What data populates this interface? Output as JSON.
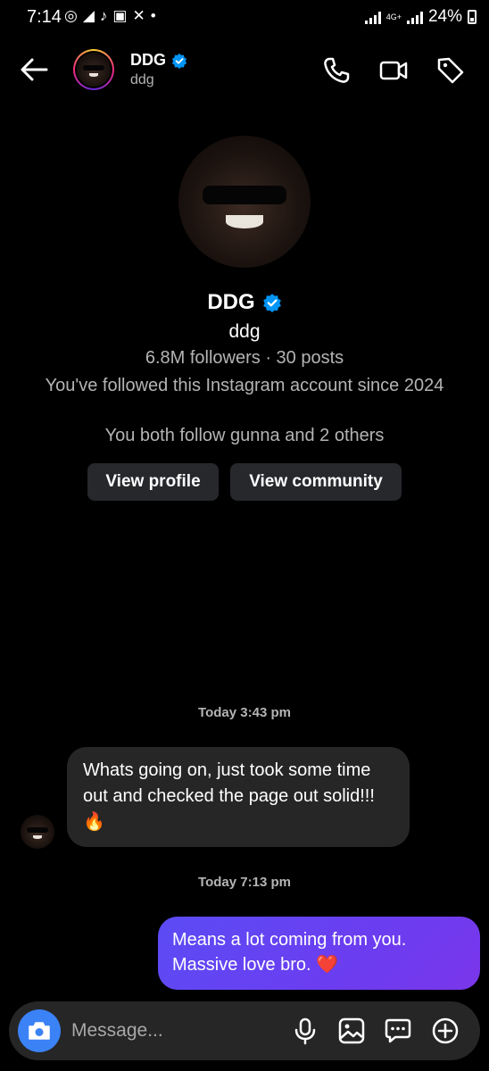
{
  "status_bar": {
    "time": "7:14",
    "app_icons": [
      "whatsapp-icon",
      "telegram-icon",
      "tiktok-icon",
      "instagram-icon",
      "x-icon"
    ],
    "network": "4G+",
    "battery": "24%"
  },
  "header": {
    "name": "DDG",
    "handle": "ddg",
    "verified": true
  },
  "profile": {
    "name": "DDG",
    "handle": "ddg",
    "stats": "6.8M followers · 30 posts",
    "since": "You've followed this Instagram account since 2024",
    "mutual": "You both follow gunna and 2 others",
    "view_profile": "View profile",
    "view_community": "View community"
  },
  "messages": [
    {
      "type": "timestamp",
      "text": "Today 3:43 pm"
    },
    {
      "type": "incoming",
      "text": "Whats going on, just took some time out and checked the page out solid!!! 🔥"
    },
    {
      "type": "timestamp",
      "text": "Today 7:13 pm"
    },
    {
      "type": "outgoing",
      "text": "Means a lot coming from you. Massive love bro. ❤️"
    }
  ],
  "composer": {
    "placeholder": "Message..."
  },
  "colors": {
    "background": "#000000",
    "incoming_bubble": "#262626",
    "outgoing_bubble": "#6340f0",
    "verified": "#0095f6",
    "camera_button": "#3b82f6"
  }
}
